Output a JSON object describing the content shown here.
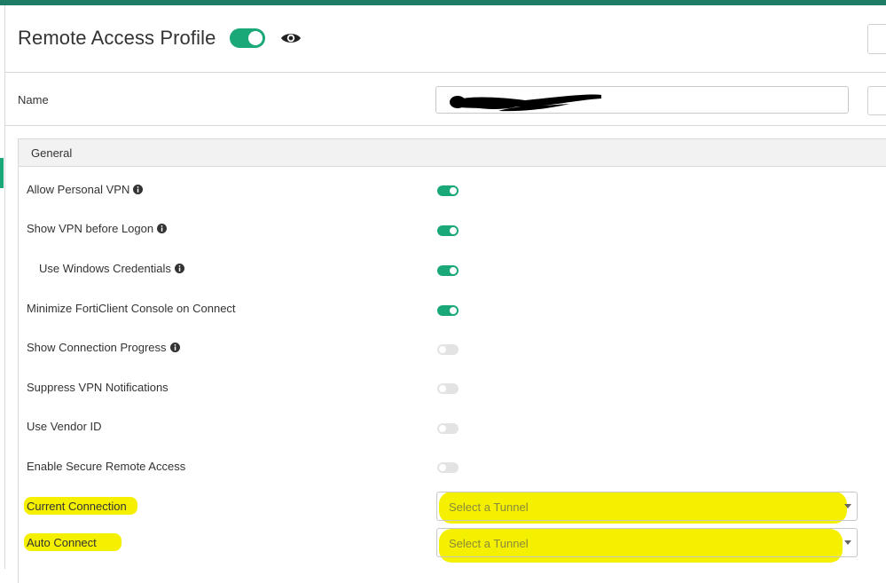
{
  "header": {
    "title": "Remote Access Profile",
    "profile_enabled": true
  },
  "name_field": {
    "label": "Name",
    "value": ""
  },
  "section": {
    "title": "General"
  },
  "settings": [
    {
      "label": "Allow Personal VPN",
      "info": true,
      "enabled": true
    },
    {
      "label": "Show VPN before Logon",
      "info": true,
      "enabled": true
    },
    {
      "label": "Use Windows Credentials",
      "info": true,
      "enabled": true
    },
    {
      "label": "Minimize FortiClient Console on Connect",
      "info": false,
      "enabled": true
    },
    {
      "label": "Show Connection Progress",
      "info": true,
      "enabled": false
    },
    {
      "label": "Suppress VPN Notifications",
      "info": false,
      "enabled": false
    },
    {
      "label": "Use Vendor ID",
      "info": false,
      "enabled": false
    },
    {
      "label": "Enable Secure Remote Access",
      "info": false,
      "enabled": false
    }
  ],
  "current_connection": {
    "label": "Current Connection",
    "placeholder": "Select a Tunnel"
  },
  "auto_connect": {
    "label": "Auto Connect",
    "placeholder": "Select a Tunnel"
  },
  "colors": {
    "accent": "#1aa879",
    "top_bar": "#1e7b64",
    "highlight": "#f4f000"
  }
}
